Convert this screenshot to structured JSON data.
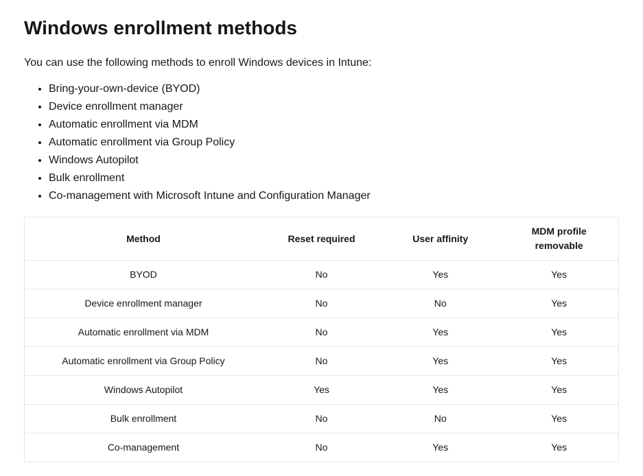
{
  "title": "Windows enrollment methods",
  "intro": "You can use the following methods to enroll Windows devices in Intune:",
  "list_items": [
    "Bring-your-own-device (BYOD)",
    "Device enrollment manager",
    "Automatic enrollment via MDM",
    "Automatic enrollment via Group Policy",
    "Windows Autopilot",
    "Bulk enrollment",
    "Co-management with Microsoft Intune and Configuration Manager"
  ],
  "table": {
    "headers": [
      "Method",
      "Reset required",
      "User affinity",
      "MDM profile removable"
    ],
    "rows": [
      [
        "BYOD",
        "No",
        "Yes",
        "Yes"
      ],
      [
        "Device enrollment manager",
        "No",
        "No",
        "Yes"
      ],
      [
        "Automatic enrollment via MDM",
        "No",
        "Yes",
        "Yes"
      ],
      [
        "Automatic enrollment via Group Policy",
        "No",
        "Yes",
        "Yes"
      ],
      [
        "Windows Autopilot",
        "Yes",
        "Yes",
        "Yes"
      ],
      [
        "Bulk enrollment",
        "No",
        "No",
        "Yes"
      ],
      [
        "Co-management",
        "No",
        "Yes",
        "Yes"
      ]
    ]
  }
}
